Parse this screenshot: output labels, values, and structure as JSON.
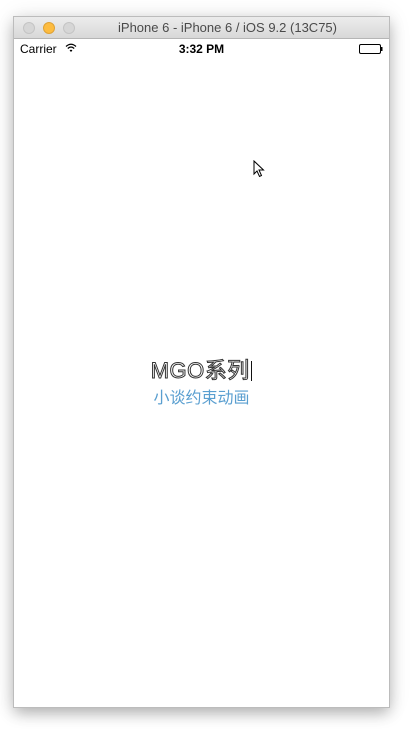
{
  "window": {
    "title": "iPhone 6 - iPhone 6 / iOS 9.2 (13C75)"
  },
  "statusbar": {
    "carrier": "Carrier",
    "time": "3:32 PM",
    "wifi_icon": "wifi-icon",
    "battery_icon": "battery-icon"
  },
  "main": {
    "title": "MGO系列",
    "subtitle": "小谈约束动画"
  },
  "colors": {
    "subtitle": "#5a9fd0",
    "minimize_button": "#fdbc40",
    "background": "#ffffff"
  }
}
